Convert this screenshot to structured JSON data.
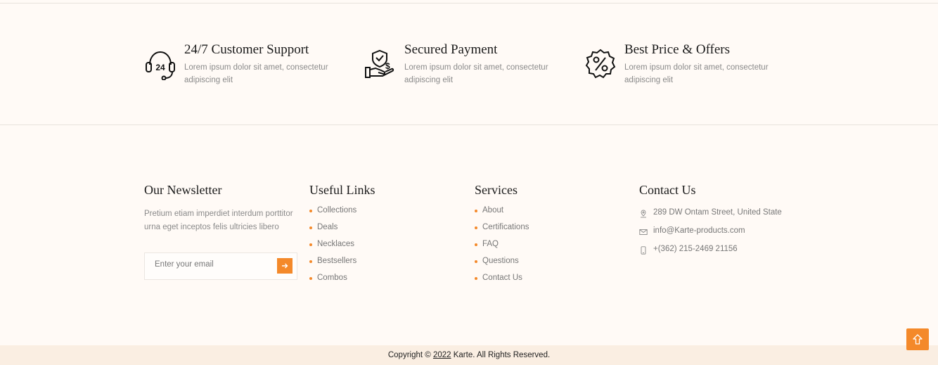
{
  "features": [
    {
      "icon": "headset-24-icon",
      "title": "24/7 Customer Support",
      "desc": "Lorem ipsum dolor sit amet, consectetur adipiscing elit"
    },
    {
      "icon": "secure-payment-hand-icon",
      "title": "Secured Payment",
      "desc": "Lorem ipsum dolor sit amet, consectetur adipiscing elit"
    },
    {
      "icon": "discount-badge-icon",
      "title": "Best Price & Offers",
      "desc": "Lorem ipsum dolor sit amet, consectetur adipiscing elit"
    }
  ],
  "newsletter": {
    "title": "Our Newsletter",
    "desc": "Pretium etiam imperdiet interdum porttitor urna eget inceptos felis ultricies libero",
    "placeholder": "Enter your email",
    "submit_icon": "arrow-right-icon"
  },
  "useful_links": {
    "title": "Useful Links",
    "items": [
      "Collections",
      "Deals",
      "Necklaces",
      "Bestsellers",
      "Combos"
    ]
  },
  "services": {
    "title": "Services",
    "items": [
      "About",
      "Certifications",
      "FAQ",
      "Questions",
      "Contact Us"
    ]
  },
  "contact": {
    "title": "Contact Us",
    "address": "289 DW Ontam Street, United State",
    "email": "info@Karte-products.com",
    "phone": "+(362) 215-2469 21156"
  },
  "footer": {
    "copyright_prefix": "Copyright ©",
    "year": "2022",
    "copyright_suffix": "Karte. All Rights Reserved."
  },
  "accent_color": "#f4892a",
  "scroll_top_icon": "arrow-up-icon"
}
